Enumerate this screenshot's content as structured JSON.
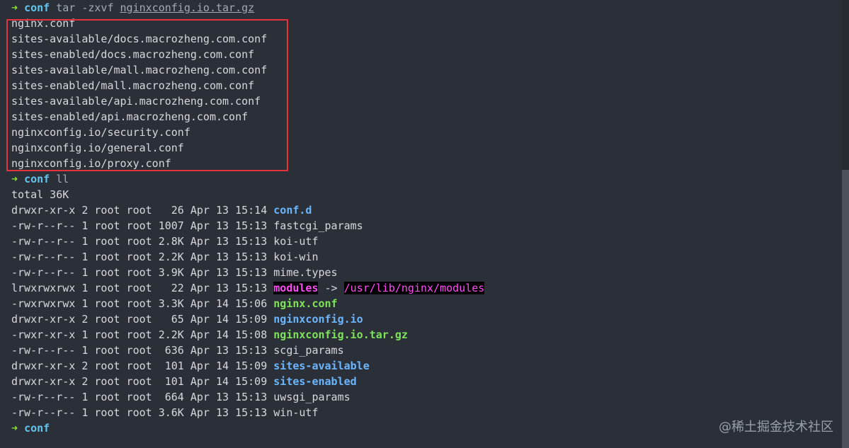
{
  "terminal": {
    "prompt_symbol": "➜",
    "prompt_dir": "conf",
    "cmd1_prefix": "tar -zxvf ",
    "cmd1_file": "nginxconfig.io.tar.gz",
    "tar_output": [
      "nginx.conf",
      "sites-available/docs.macrozheng.com.conf",
      "sites-enabled/docs.macrozheng.com.conf",
      "sites-available/mall.macrozheng.com.conf",
      "sites-enabled/mall.macrozheng.com.conf",
      "sites-available/api.macrozheng.com.conf",
      "sites-enabled/api.macrozheng.com.conf",
      "nginxconfig.io/security.conf",
      "nginxconfig.io/general.conf",
      "nginxconfig.io/proxy.conf"
    ],
    "cmd2": "ll",
    "total": "total 36K",
    "listing": [
      {
        "meta": "drwxr-xr-x 2 root root   26 Apr 13 15:14 ",
        "name": "conf.d",
        "kind": "dir"
      },
      {
        "meta": "-rw-r--r-- 1 root root 1007 Apr 13 15:13 ",
        "name": "fastcgi_params",
        "kind": "plain"
      },
      {
        "meta": "-rw-r--r-- 1 root root 2.8K Apr 13 15:13 ",
        "name": "koi-utf",
        "kind": "plain"
      },
      {
        "meta": "-rw-r--r-- 1 root root 2.2K Apr 13 15:13 ",
        "name": "koi-win",
        "kind": "plain"
      },
      {
        "meta": "-rw-r--r-- 1 root root 3.9K Apr 13 15:13 ",
        "name": "mime.types",
        "kind": "plain"
      },
      {
        "meta": "lrwxrwxrwx 1 root root   22 Apr 13 15:13 ",
        "name": "modules",
        "kind": "link",
        "arrow": " -> ",
        "target": "/usr/lib/nginx/modules"
      },
      {
        "meta": "-rwxrwxrwx 1 root root 3.3K Apr 14 15:06 ",
        "name": "nginx.conf",
        "kind": "exe"
      },
      {
        "meta": "drwxr-xr-x 2 root root   65 Apr 14 15:09 ",
        "name": "nginxconfig.io",
        "kind": "dir"
      },
      {
        "meta": "-rwxr-xr-x 1 root root 2.2K Apr 14 15:08 ",
        "name": "nginxconfig.io.tar.gz",
        "kind": "exe"
      },
      {
        "meta": "-rw-r--r-- 1 root root  636 Apr 13 15:13 ",
        "name": "scgi_params",
        "kind": "plain"
      },
      {
        "meta": "drwxr-xr-x 2 root root  101 Apr 14 15:09 ",
        "name": "sites-available",
        "kind": "dir"
      },
      {
        "meta": "drwxr-xr-x 2 root root  101 Apr 14 15:09 ",
        "name": "sites-enabled",
        "kind": "dir"
      },
      {
        "meta": "-rw-r--r-- 1 root root  664 Apr 13 15:13 ",
        "name": "uwsgi_params",
        "kind": "plain"
      },
      {
        "meta": "-rw-r--r-- 1 root root 3.6K Apr 13 15:13 ",
        "name": "win-utf",
        "kind": "plain"
      }
    ]
  },
  "watermark": "@稀土掘金技术社区",
  "colors": {
    "background": "#2b3038",
    "prompt_arrow": "#8ae234",
    "prompt_dir": "#61c5f0",
    "directory": "#6cb6ff",
    "executable": "#7ee25b",
    "symlink": "#ff4df7",
    "highlight_box": "#e5323f"
  }
}
